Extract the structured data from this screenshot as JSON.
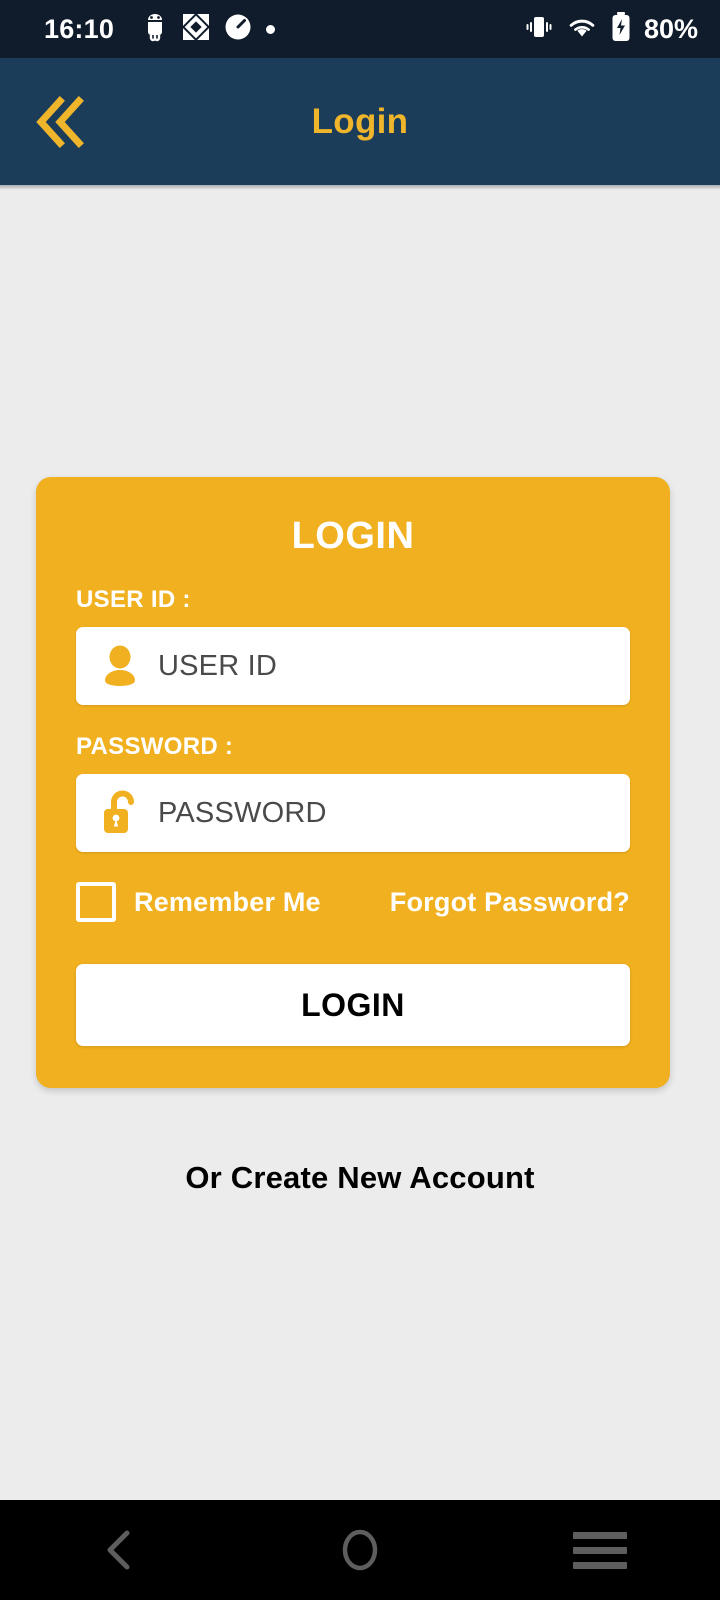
{
  "status_bar": {
    "time": "16:10",
    "battery_percent": "80%",
    "left_icons": [
      "android-debug-icon",
      "developer-options-icon",
      "speedometer-icon",
      "notification-dot-icon"
    ],
    "right_icons": [
      "vibrate-icon",
      "wifi-icon",
      "battery-charging-icon"
    ],
    "background_color": "#101C2B"
  },
  "app_bar": {
    "title": "Login",
    "back_icon": "double-chevron-left-icon",
    "background_color": "#1C3D5A",
    "accent_color": "#EFB52B"
  },
  "login_card": {
    "title": "LOGIN",
    "background_color": "#F0B01F",
    "user_id": {
      "label": "USER ID :",
      "placeholder": "USER ID",
      "value": "",
      "icon": "user-person-icon"
    },
    "password": {
      "label": "PASSWORD :",
      "placeholder": "PASSWORD",
      "value": "",
      "icon": "unlocked-padlock-icon"
    },
    "remember_me": {
      "label": "Remember Me",
      "checked": false
    },
    "forgot_password": "Forgot Password?",
    "submit_label": "LOGIN"
  },
  "create_account": "Or Create New Account",
  "nav_bar": {
    "back_icon": "chevron-left-icon",
    "home_icon": "circle-home-icon",
    "recents_icon": "hamburger-recents-icon",
    "background_color": "#000000"
  },
  "page_background_color": "#ECECEC"
}
